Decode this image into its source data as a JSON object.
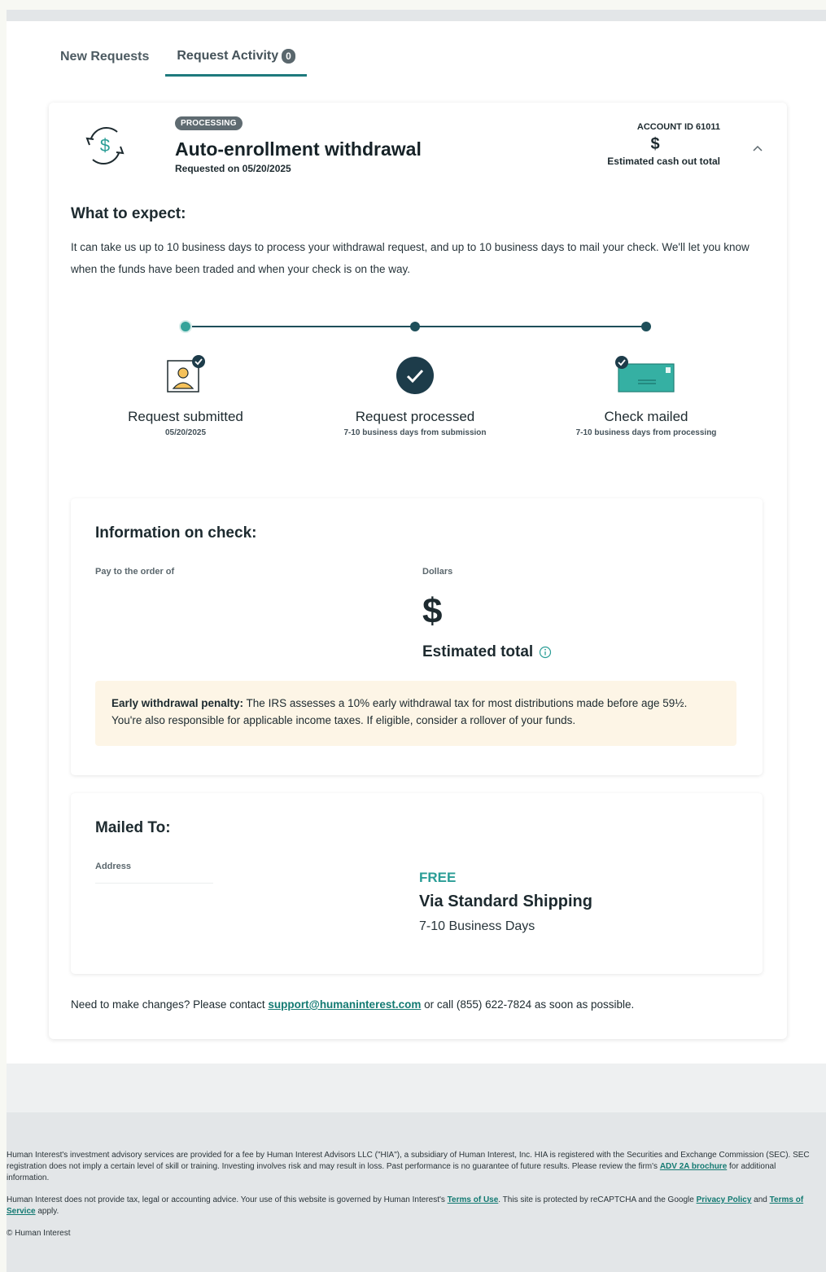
{
  "tabs": {
    "new_requests": "New Requests",
    "request_activity": "Request Activity",
    "request_activity_count": "0"
  },
  "request": {
    "status": "PROCESSING",
    "title": "Auto-enrollment withdrawal",
    "requested_on": "Requested on 05/20/2025",
    "account_id": "ACCOUNT ID 61011",
    "amount": "$",
    "amount_label": "Estimated cash out total"
  },
  "expect": {
    "title": "What to expect:",
    "text": "It can take us up to 10 business days to process your withdrawal request, and up to 10 business days to mail your check. We'll let you know when the funds have been traded and when your check is on the way."
  },
  "steps": [
    {
      "name": "Request submitted",
      "sub": "05/20/2025"
    },
    {
      "name": "Request processed",
      "sub": "7-10 business days from submission"
    },
    {
      "name": "Check mailed",
      "sub": "7-10 business days from processing"
    }
  ],
  "check": {
    "title": "Information on check:",
    "pay_to_label": "Pay to the order of",
    "dollars_label": "Dollars",
    "dollar_sign": "$",
    "estimated_total": "Estimated total",
    "penalty_bold": "Early withdrawal penalty:",
    "penalty_text": " The IRS assesses a 10% early withdrawal tax for most distributions made before age 59½. You're also responsible for applicable income taxes. If eligible, consider a rollover of your funds."
  },
  "mailed": {
    "title": "Mailed To:",
    "address_label": "Address",
    "free": "FREE",
    "shipping": "Via Standard Shipping",
    "days": "7-10 Business Days"
  },
  "contact": {
    "before": "Need to make changes? Please contact ",
    "email": "support@humaninterest.com",
    "after": " or call (855) 622-7824 as soon as possible."
  },
  "footer": {
    "p1_a": "Human Interest's investment advisory services are provided for a fee by Human Interest Advisors LLC (\"HIA\"), a subsidiary of Human Interest, Inc. HIA is registered with the Securities and Exchange Commission (SEC). SEC registration does not imply a certain level of skill or training. Investing involves risk and may result in loss. Past performance is no guarantee of future results. Please review the firm's ",
    "p1_link": "ADV 2A brochure",
    "p1_b": " for additional information.",
    "p2_a": "Human Interest does not provide tax, legal or accounting advice. Your use of this website is governed by Human Interest's ",
    "p2_link1": "Terms of Use",
    "p2_b": ". This site is protected by reCAPTCHA and the Google ",
    "p2_link2": "Privacy Policy",
    "p2_c": " and ",
    "p2_link3": "Terms of Service",
    "p2_d": " apply.",
    "copyright": "© Human Interest"
  },
  "colors": {
    "accent": "#1e7a7d",
    "teal": "#2a9d96",
    "penalty_bg": "#fdf5e6",
    "footer_bg": "#e3e6e8"
  }
}
